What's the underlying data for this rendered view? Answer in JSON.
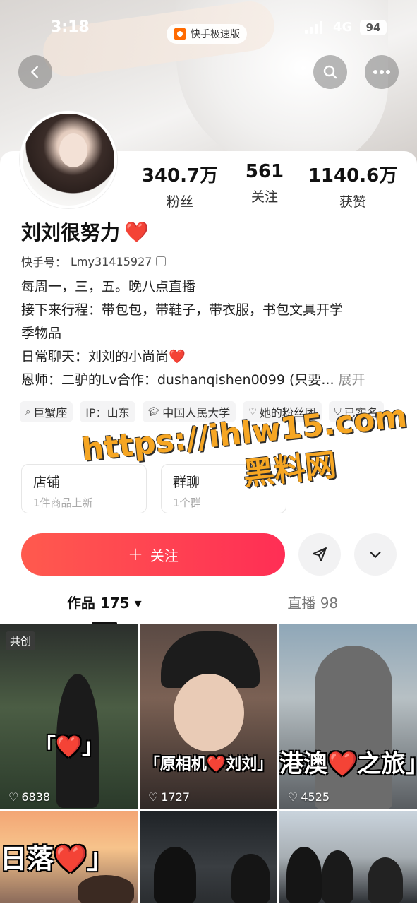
{
  "status_bar": {
    "time": "3:18",
    "app_name": "快手极速版",
    "network": "4G",
    "battery": "94"
  },
  "profile": {
    "name": "刘刘很努力",
    "name_emoji": "❤️",
    "uid_label": "快手号：",
    "uid": "Lmy31415927",
    "stats": [
      {
        "value": "340.7万",
        "label": "粉丝"
      },
      {
        "value": "561",
        "label": "关注"
      },
      {
        "value": "1140.6万",
        "label": "获赞"
      }
    ],
    "bio": [
      "每周一，三，五。晚八点直播",
      "接下来行程：带包包，带鞋子，带衣服，书包文具开学",
      "季物品",
      "日常聊天：刘刘的小尚尚❤️",
      "恩师：二驴的Lv合作：dushanqishen0099 (只要..."
    ],
    "bio_expand": "展开",
    "tags": [
      {
        "icon": "search-icon",
        "label": "巨蟹座"
      },
      {
        "icon": "",
        "label": "IP：山东"
      },
      {
        "icon": "graduation-cap-icon",
        "label": "中国人民大学"
      },
      {
        "icon": "heart-outline-icon",
        "label": "她的粉丝团"
      },
      {
        "icon": "shield-icon",
        "label": "已实名"
      }
    ]
  },
  "entries": {
    "shop": {
      "title": "店铺",
      "subtitle": "1件商品上新"
    },
    "group": {
      "title": "群聊",
      "subtitle": "1个群"
    }
  },
  "watermark": {
    "line1": "https://ihlw15.com",
    "line2": "黑料网"
  },
  "actions": {
    "follow_label": "关注",
    "follow_icon": "+"
  },
  "tabs": [
    {
      "label": "作品 175 ▾",
      "active": true
    },
    {
      "label": "直播 98",
      "active": false
    }
  ],
  "videos": [
    {
      "badge": "共创",
      "caption": "「❤️」",
      "likes": "6838"
    },
    {
      "badge": "",
      "caption": "「原相机❤️刘刘」",
      "likes": "1727"
    },
    {
      "badge": "",
      "caption": "港澳❤️之旅」",
      "likes": "4525"
    },
    {
      "badge": "",
      "caption": "日落❤️」",
      "likes": ""
    },
    {
      "badge": "",
      "caption": "",
      "likes": ""
    },
    {
      "badge": "",
      "caption": "",
      "likes": ""
    }
  ],
  "colors": {
    "accent": "#ff3355",
    "heart": "#f0233a",
    "watermark": "#f6a623"
  }
}
